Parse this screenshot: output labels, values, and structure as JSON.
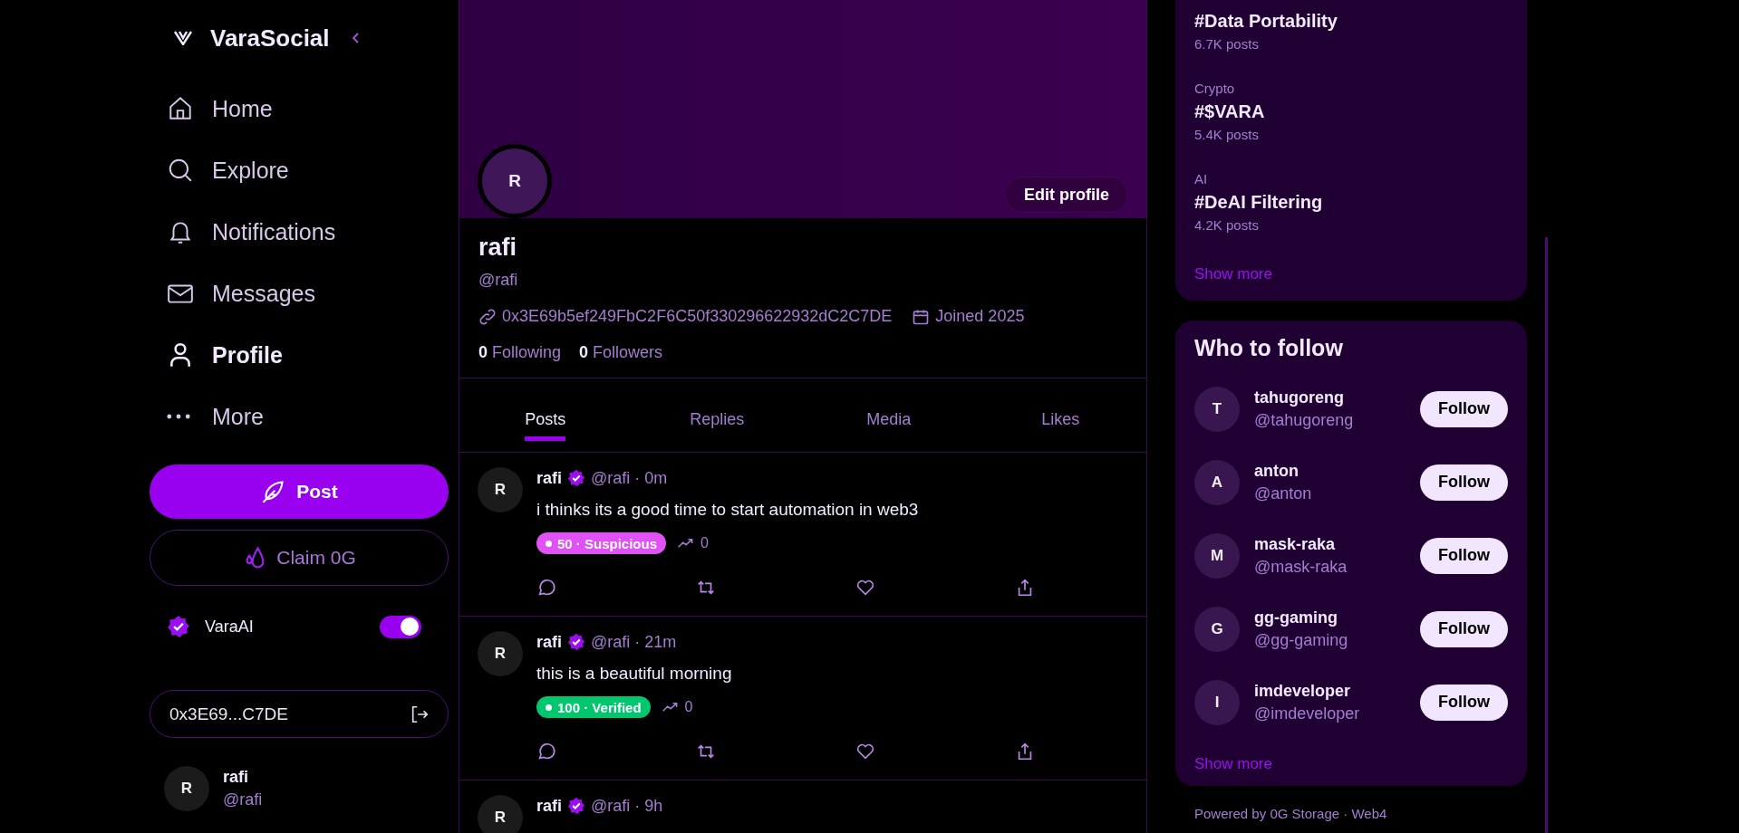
{
  "brand": {
    "name": "VaraSocial"
  },
  "nav": [
    {
      "label": "Home",
      "selected": false
    },
    {
      "label": "Explore",
      "selected": false
    },
    {
      "label": "Notifications",
      "selected": false
    },
    {
      "label": "Messages",
      "selected": false
    },
    {
      "label": "Profile",
      "selected": true
    },
    {
      "label": "More",
      "selected": false
    }
  ],
  "post_button": "Post",
  "claim_button": "Claim 0G",
  "vara_ai": {
    "label": "VaraAI",
    "on": true
  },
  "wallet_button": "0x3E69...C7DE",
  "account": {
    "initial": "R",
    "name": "rafi",
    "handle": "@rafi"
  },
  "profile": {
    "initial": "R",
    "edit_button": "Edit profile",
    "name": "rafi",
    "handle": "@rafi",
    "address": "0x3E69b5ef249FbC2F6C50f330296622932dC2C7DE",
    "joined": "Joined 2025",
    "following_count": "0",
    "following_label": "Following",
    "followers_count": "0",
    "followers_label": "Followers"
  },
  "tabs": [
    {
      "label": "Posts",
      "selected": true
    },
    {
      "label": "Replies",
      "selected": false
    },
    {
      "label": "Media",
      "selected": false
    },
    {
      "label": "Likes",
      "selected": false
    }
  ],
  "posts": [
    {
      "initial": "R",
      "name": "rafi",
      "handle": "@rafi · 0m",
      "text": "i thinks its a good time to start automation in web3",
      "badge": {
        "label": "50 · Suspicious",
        "color": "#e052f5"
      },
      "views": "0"
    },
    {
      "initial": "R",
      "name": "rafi",
      "handle": "@rafi · 21m",
      "text": "this is a beautiful morning",
      "badge": {
        "label": "100 · Verified",
        "color": "#00c66e"
      },
      "views": "0"
    },
    {
      "initial": "R",
      "name": "rafi",
      "handle": "@rafi · 9h"
    }
  ],
  "trends": {
    "items": [
      {
        "tag": "#Data Portability",
        "posts": "6.7K posts"
      },
      {
        "category": "Crypto",
        "tag": "#$VARA",
        "posts": "5.4K posts"
      },
      {
        "category": "AI",
        "tag": "#DeAI Filtering",
        "posts": "4.2K posts"
      }
    ],
    "show_more": "Show more"
  },
  "who_to_follow": {
    "title": "Who to follow",
    "users": [
      {
        "initial": "T",
        "name": "tahugoreng",
        "handle": "@tahugoreng",
        "button": "Follow"
      },
      {
        "initial": "A",
        "name": "anton",
        "handle": "@anton",
        "button": "Follow"
      },
      {
        "initial": "M",
        "name": "mask-raka",
        "handle": "@mask-raka",
        "button": "Follow"
      },
      {
        "initial": "G",
        "name": "gg-gaming",
        "handle": "@gg-gaming",
        "button": "Follow"
      },
      {
        "initial": "I",
        "name": "imdeveloper",
        "handle": "@imdeveloper",
        "button": "Follow"
      }
    ],
    "show_more": "Show more"
  },
  "footer": "Powered by 0G Storage · Web4"
}
